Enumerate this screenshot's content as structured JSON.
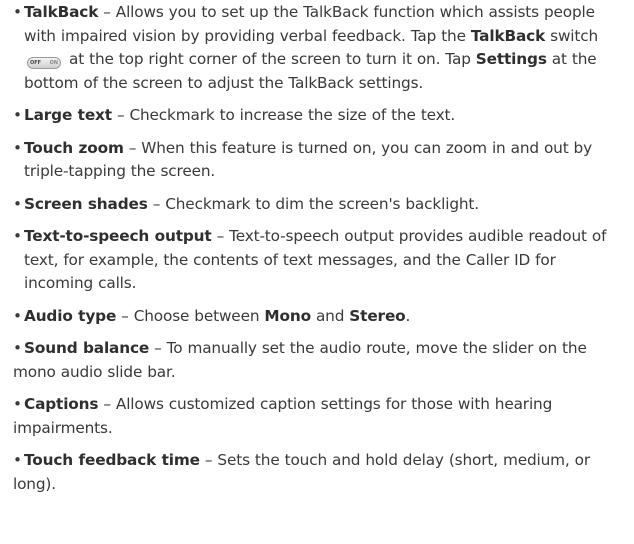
{
  "items": {
    "talkback": {
      "term": "TalkBack",
      "p1": " – Allows you to set up the TalkBack function which assists people with impaired vision by providing verbal feedback. Tap the ",
      "em1": "TalkBack",
      "p2": " switch ",
      "toggle_off": "OFF",
      "toggle_on": "ON",
      "p3": " at the top right corner of the screen to turn it on. Tap ",
      "em2": "Settings",
      "p4": " at the bottom of the screen to adjust the TalkBack settings."
    },
    "large_text": {
      "term": "Large text",
      "desc": " – Checkmark to increase the size of the text."
    },
    "touch_zoom": {
      "term": "Touch zoom",
      "desc": " – When this feature is turned on, you can zoom in and out by triple-tapping the screen."
    },
    "screen_shades": {
      "term": "Screen shades",
      "desc": " – Checkmark to dim the screen's backlight."
    },
    "tts": {
      "term": "Text-to-speech output",
      "desc": " – Text-to-speech output provides audible readout of text, for example, the contents of text messages, and the Caller ID for incoming calls."
    },
    "audio_type": {
      "term": "Audio type",
      "p1": " – Choose between ",
      "em1": "Mono",
      "p2": " and ",
      "em2": "Stereo",
      "p3": "."
    },
    "sound_balance": {
      "term": "Sound balance",
      "desc": " – To manually set the audio route, move the slider on the mono audio slide bar."
    },
    "captions": {
      "term": "Captions",
      "desc": " – Allows customized caption settings for those with hearing impairments."
    },
    "touch_feedback": {
      "term": "Touch feedback time",
      "desc": " – Sets the touch and hold delay (short, medium, or long)."
    }
  },
  "bullet": "•"
}
